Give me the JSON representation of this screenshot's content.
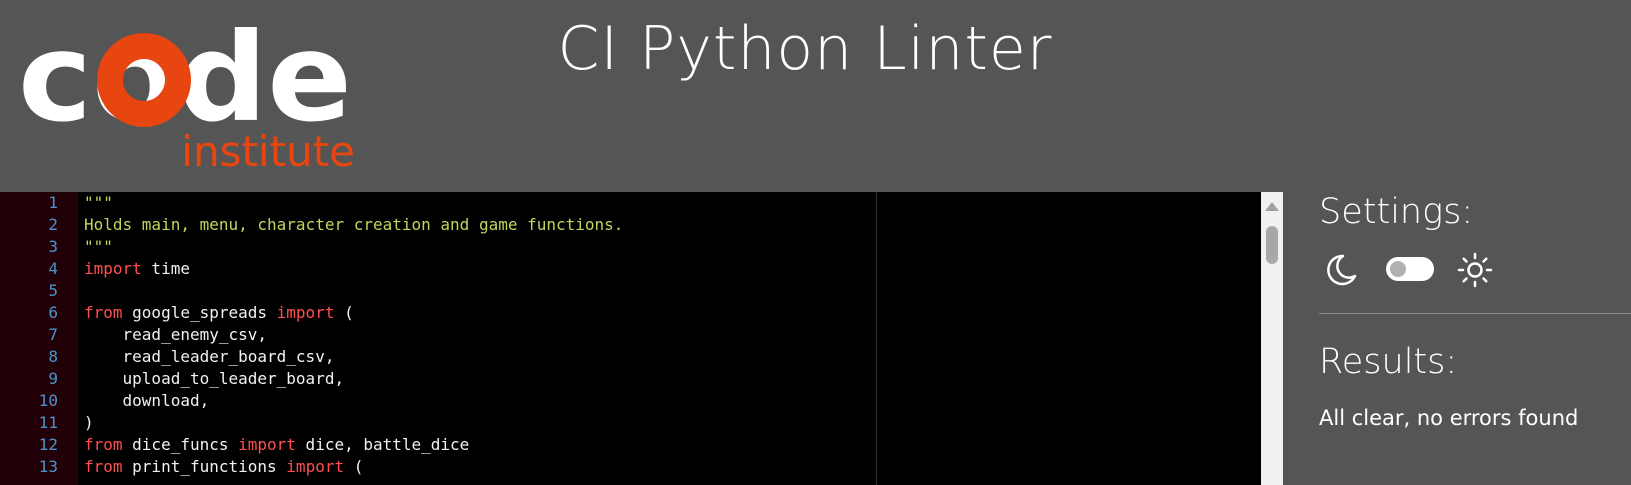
{
  "header": {
    "title": "CI Python Linter",
    "logo": {
      "word": "code",
      "subword": "institute",
      "accent_color": "#e84610"
    }
  },
  "editor": {
    "lines": [
      {
        "number": "1",
        "tokens": [
          {
            "t": "\"\"\"",
            "c": "str"
          }
        ]
      },
      {
        "number": "2",
        "tokens": [
          {
            "t": "Holds main, menu, character creation and game functions.",
            "c": "str"
          }
        ]
      },
      {
        "number": "3",
        "tokens": [
          {
            "t": "\"\"\"",
            "c": "str"
          }
        ]
      },
      {
        "number": "4",
        "tokens": [
          {
            "t": "import",
            "c": "kw"
          },
          {
            "t": " time",
            "c": "plain"
          }
        ]
      },
      {
        "number": "5",
        "tokens": []
      },
      {
        "number": "6",
        "tokens": [
          {
            "t": "from",
            "c": "kw"
          },
          {
            "t": " google_spreads ",
            "c": "plain"
          },
          {
            "t": "import",
            "c": "kw"
          },
          {
            "t": " (",
            "c": "plain"
          }
        ]
      },
      {
        "number": "7",
        "tokens": [
          {
            "t": "    read_enemy_csv,",
            "c": "plain"
          }
        ]
      },
      {
        "number": "8",
        "tokens": [
          {
            "t": "    read_leader_board_csv,",
            "c": "plain"
          }
        ]
      },
      {
        "number": "9",
        "tokens": [
          {
            "t": "    upload_to_leader_board,",
            "c": "plain"
          }
        ]
      },
      {
        "number": "10",
        "tokens": [
          {
            "t": "    download,",
            "c": "plain"
          }
        ]
      },
      {
        "number": "11",
        "tokens": [
          {
            "t": ")",
            "c": "plain"
          }
        ]
      },
      {
        "number": "12",
        "tokens": [
          {
            "t": "from",
            "c": "kw"
          },
          {
            "t": " dice_funcs ",
            "c": "plain"
          },
          {
            "t": "import",
            "c": "kw"
          },
          {
            "t": " dice, battle_dice",
            "c": "plain"
          }
        ]
      },
      {
        "number": "13",
        "tokens": [
          {
            "t": "from",
            "c": "kw"
          },
          {
            "t": " print_functions ",
            "c": "plain"
          },
          {
            "t": "import",
            "c": "kw"
          },
          {
            "t": " (",
            "c": "plain"
          }
        ]
      }
    ]
  },
  "settings": {
    "title": "Settings:",
    "theme_toggle": "dark",
    "icons": [
      "moon-icon",
      "sun-icon"
    ]
  },
  "results": {
    "title": "Results:",
    "message": "All clear, no errors found"
  }
}
